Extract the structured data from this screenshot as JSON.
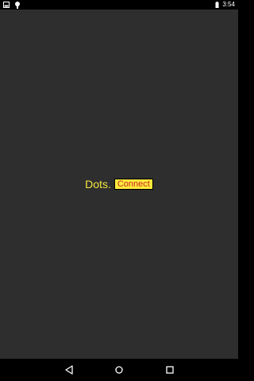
{
  "status_bar": {
    "time": "3:54",
    "left_icons": [
      "image-notification-icon",
      "android-notification-icon"
    ],
    "right_icons": [
      "battery-icon"
    ]
  },
  "main": {
    "title": "Dots.",
    "connect_label": "Connect"
  },
  "nav_bar": {
    "buttons": [
      "back-icon",
      "home-icon",
      "recent-apps-icon"
    ]
  },
  "colors": {
    "background": "#2e2e2e",
    "title": "#f5e642",
    "button_bg": "#ffeb3b",
    "button_text": "#c62828",
    "bars": "#000000"
  }
}
